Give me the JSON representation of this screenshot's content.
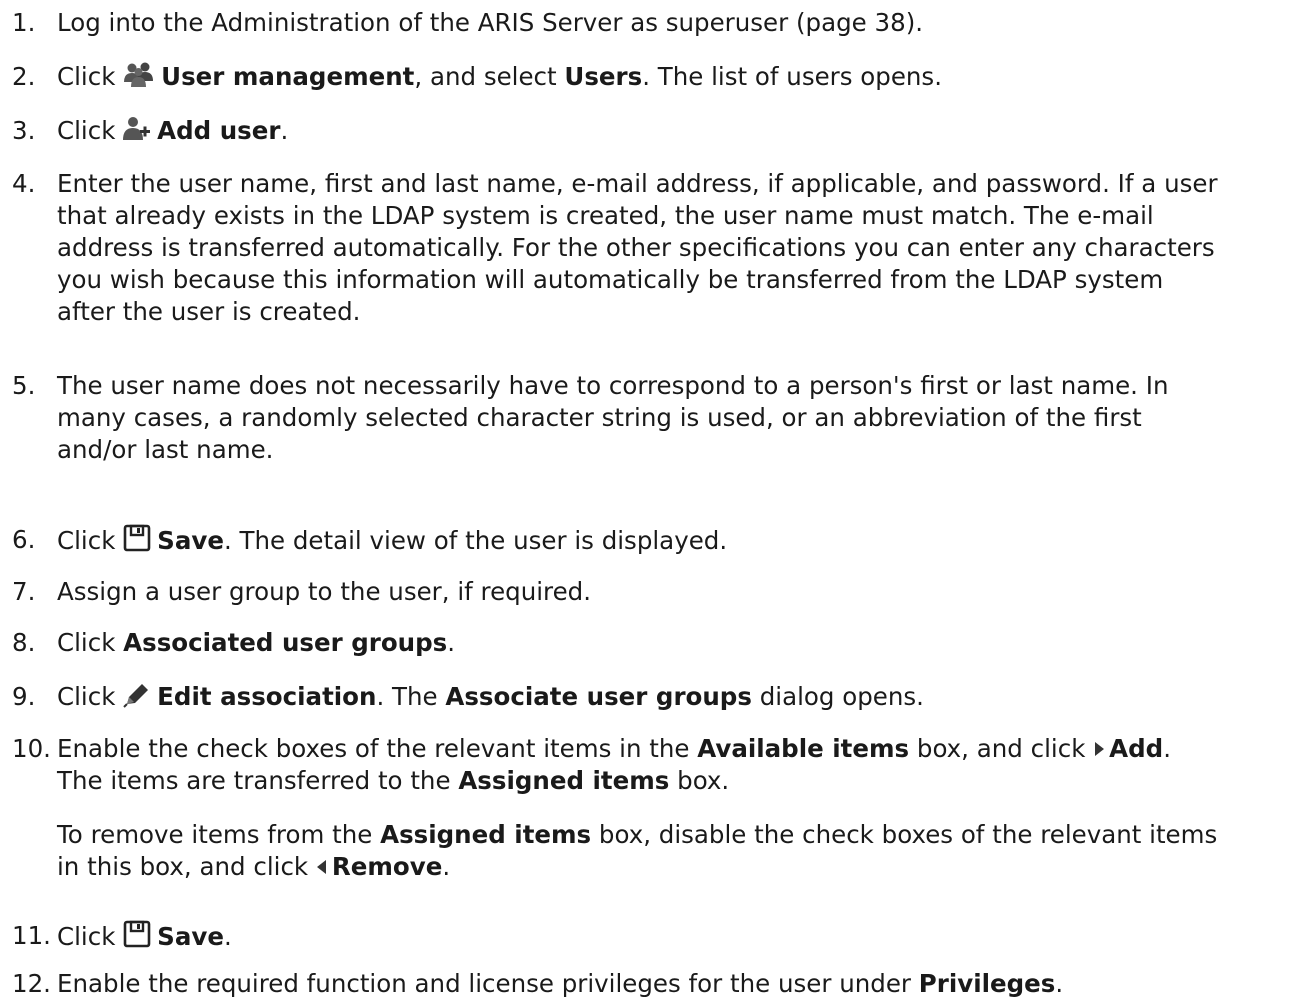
{
  "steps": [
    {
      "num": "1.",
      "text": "Log into the Administration of the ARIS Server as superuser (page 38)."
    },
    {
      "num": "2.",
      "a": "Click ",
      "icon": "users-icon",
      "b": "User management",
      "c": ", and select ",
      "d": "Users",
      "e": ". The list of users opens."
    },
    {
      "num": "3.",
      "a": "Click ",
      "icon": "add-user-icon",
      "b": "Add user",
      "c": "."
    },
    {
      "num": "4.",
      "lines": [
        "Enter the user name, first and last name, e-mail address, if applicable, and password. If a user",
        "that already exists in the LDAP system is created, the user name must match. The e-mail",
        "address is transferred automatically. For the other specifications you can enter any characters",
        "you wish because this information will automatically be transferred from the LDAP system",
        "after the user is created."
      ]
    },
    {
      "num": "5.",
      "lines": [
        "The user name does not necessarily have to correspond to a person's first or last name. In",
        "many cases, a randomly selected character string is used, or an abbreviation of the first",
        "and/or last name."
      ]
    },
    {
      "num": "6.",
      "a": "Click ",
      "icon": "save-icon",
      "b": "Save",
      "c": ". The detail view of the user is displayed."
    },
    {
      "num": "7.",
      "text": "Assign a user group to the user, if required."
    },
    {
      "num": "8.",
      "a": "Click ",
      "b": "Associated user groups",
      "c": "."
    },
    {
      "num": "9.",
      "a": "Click ",
      "icon": "pencil-icon",
      "b": "Edit association",
      "c": ". The ",
      "d": "Associate user groups",
      "e": " dialog opens."
    },
    {
      "num": "10.",
      "l1a": "Enable the check boxes of the relevant items in the ",
      "l1b": "Available items",
      "l1c": " box, and click ",
      "icon": "add-arrow-icon",
      "l1d": "Add",
      "l1e": ".",
      "l2a": "The items are transferred to the ",
      "l2b": "Assigned items",
      "l2c": " box.",
      "p1a": "To remove items from the ",
      "p1b": "Assigned items",
      "p1c": " box, disable the check boxes of the relevant items",
      "p2a": "in this box, and click ",
      "icon2": "remove-arrow-icon",
      "p2b": "Remove",
      "p2c": "."
    },
    {
      "num": "11.",
      "a": "Click ",
      "icon": "save-icon",
      "b": "Save",
      "c": "."
    },
    {
      "num": "12.",
      "a": "Enable the required function and license privileges for the user under ",
      "b": "Privileges",
      "c": "."
    }
  ]
}
